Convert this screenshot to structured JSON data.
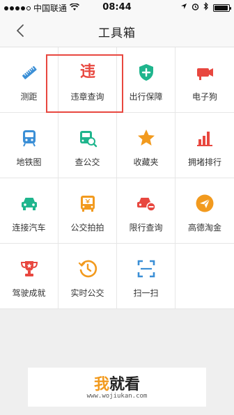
{
  "status_bar": {
    "carrier": "中国联通",
    "time": "08:44"
  },
  "nav": {
    "title": "工具箱"
  },
  "tools": [
    {
      "label": "测距",
      "icon": "ruler-icon",
      "color": "#3b8fd6"
    },
    {
      "label": "违章查询",
      "icon": "violation-icon",
      "color": "#e8473f",
      "icon_text": "违"
    },
    {
      "label": "出行保障",
      "icon": "shield-plus-icon",
      "color": "#1fb58d"
    },
    {
      "label": "电子狗",
      "icon": "camera-icon",
      "color": "#e8473f"
    },
    {
      "label": "地铁图",
      "icon": "subway-icon",
      "color": "#3b8fd6"
    },
    {
      "label": "查公交",
      "icon": "bus-search-icon",
      "color": "#1fb58d"
    },
    {
      "label": "收藏夹",
      "icon": "star-icon",
      "color": "#f29a1e"
    },
    {
      "label": "拥堵排行",
      "icon": "bar-chart-icon",
      "color": "#e8473f"
    },
    {
      "label": "连接汽车",
      "icon": "car-icon",
      "color": "#1fb58d"
    },
    {
      "label": "公交拍拍",
      "icon": "bus-photo-icon",
      "color": "#f29a1e"
    },
    {
      "label": "限行查询",
      "icon": "car-restrict-icon",
      "color": "#e8473f"
    },
    {
      "label": "高德淘金",
      "icon": "paper-plane-icon",
      "color": "#f29a1e"
    },
    {
      "label": "驾驶成就",
      "icon": "trophy-icon",
      "color": "#e8473f"
    },
    {
      "label": "实时公交",
      "icon": "clock-icon",
      "color": "#f29a1e"
    },
    {
      "label": "扫一扫",
      "icon": "scan-icon",
      "color": "#3b8fd6"
    }
  ],
  "watermark": {
    "accent": "我",
    "rest": "就看",
    "url": "www.wojiukan.com"
  }
}
